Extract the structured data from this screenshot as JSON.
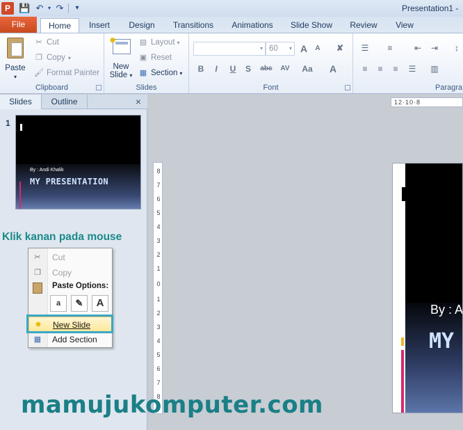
{
  "window": {
    "title": "Presentation1 -"
  },
  "quick_access": {
    "icons": [
      "powerpoint-logo",
      "save-icon",
      "undo-icon",
      "redo-icon",
      "customize-dropdown-icon"
    ]
  },
  "app": {
    "logo_letter": "P"
  },
  "tabs": [
    {
      "label": "File"
    },
    {
      "label": "Home"
    },
    {
      "label": "Insert"
    },
    {
      "label": "Design"
    },
    {
      "label": "Transitions"
    },
    {
      "label": "Animations"
    },
    {
      "label": "Slide Show"
    },
    {
      "label": "Review"
    },
    {
      "label": "View"
    }
  ],
  "ribbon": {
    "clipboard": {
      "label": "Clipboard",
      "paste": "Paste",
      "cut": "Cut",
      "copy": "Copy",
      "format_painter": "Format Painter"
    },
    "slides": {
      "label": "Slides",
      "new_slide_line1": "New",
      "new_slide_line2": "Slide",
      "layout": "Layout",
      "reset": "Reset",
      "section": "Section"
    },
    "font": {
      "label": "Font",
      "font_name": "",
      "font_size": "60",
      "bold": "B",
      "italic": "I",
      "underline": "U",
      "shadow": "S",
      "strike": "abc",
      "spacing": "AV",
      "case": "Aa",
      "color": "A",
      "grow": "A",
      "shrink": "A"
    },
    "paragraph": {
      "label": "Paragra"
    }
  },
  "left_pane": {
    "tabs": {
      "slides": "Slides",
      "outline": "Outline"
    },
    "close_glyph": "×",
    "slide_number": "1",
    "thumbnail": {
      "byline": "By : Andi Khalik",
      "title": "MY PRESENTATION"
    }
  },
  "annotation": {
    "instruction": "Klik kanan pada mouse",
    "watermark": "mamujukomputer.com"
  },
  "context_menu": {
    "cut": "Cut",
    "copy": "Copy",
    "paste_options": "Paste Options:",
    "paste_glyphs": [
      "a",
      "✎",
      "A"
    ],
    "new_slide": "New Slide",
    "add_section": "Add Section"
  },
  "ruler": {
    "vertical_labels": [
      "8",
      "7",
      "6",
      "5",
      "4",
      "3",
      "2",
      "1",
      "0",
      "1",
      "2",
      "3",
      "4",
      "5",
      "6",
      "7",
      "8"
    ],
    "horizontal_text": "12·10·8"
  },
  "main_slide": {
    "byline": "By : A",
    "title": "MY"
  },
  "colors": {
    "accent_orange": "#d24726",
    "teal_text": "#1b8a8a",
    "highlight_cyan": "#3aa8c6",
    "slide_pink": "#d42a6e"
  }
}
